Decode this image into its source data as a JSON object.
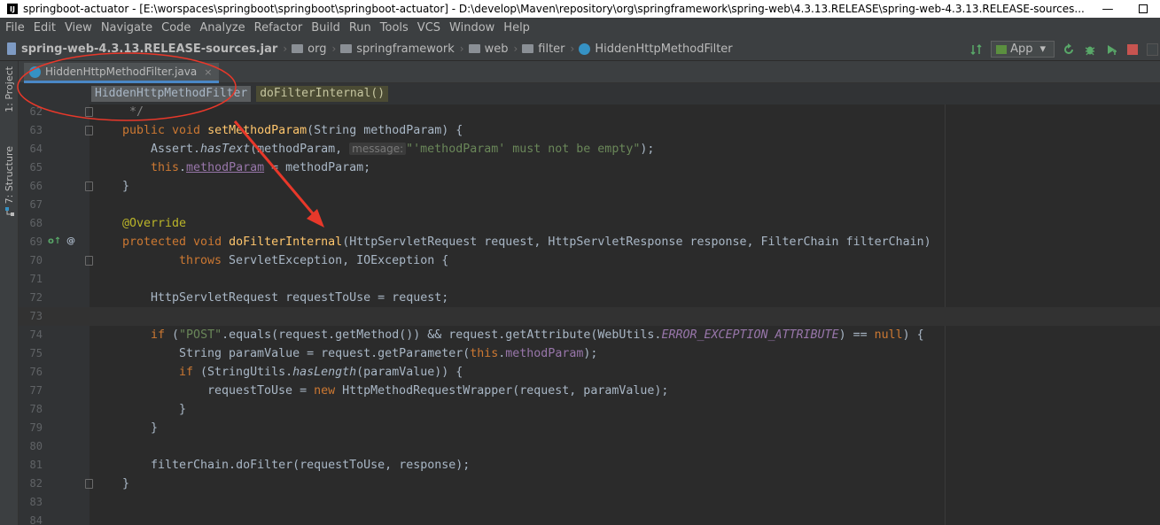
{
  "window": {
    "title": "springboot-actuator - [E:\\worspaces\\springboot\\springboot\\springboot-actuator] - D:\\develop\\Maven\\repository\\org\\springframework\\spring-web\\4.3.13.RELEASE\\spring-web-4.3.13.RELEASE-sources...",
    "minimize_glyph": "—",
    "app_icon_glyph": "IJ"
  },
  "menu": [
    "File",
    "Edit",
    "View",
    "Navigate",
    "Code",
    "Analyze",
    "Refactor",
    "Build",
    "Run",
    "Tools",
    "VCS",
    "Window",
    "Help"
  ],
  "navbar": {
    "jar": "spring-web-4.3.13.RELEASE-sources.jar",
    "crumbs": [
      "org",
      "springframework",
      "web",
      "filter",
      "HiddenHttpMethodFilter"
    ],
    "separator": "›",
    "run_config": "App",
    "run_config_arrow": "▾"
  },
  "toolstrip": {
    "project": "1: Project",
    "structure": "7: Structure"
  },
  "tab": {
    "name": "HiddenHttpMethodFilter.java",
    "close": "×"
  },
  "breadcrumb": {
    "class": "HiddenHttpMethodFilter",
    "method": "doFilterInternal()"
  },
  "code": {
    "line_numbers": [
      "62",
      "63",
      "64",
      "65",
      "66",
      "67",
      "68",
      "69",
      "70",
      "71",
      "72",
      "73",
      "74",
      "75",
      "76",
      "77",
      "78",
      "79",
      "80",
      "81",
      "82",
      "83",
      "84"
    ],
    "l62": "*/",
    "l63": {
      "kw": "public void ",
      "name": "setMethodParam",
      "rest": "(String methodParam) {"
    },
    "l64": {
      "pre": "Assert.",
      "call": "hasText",
      "mid": "(methodParam, ",
      "hint": "message:",
      "str": "\"'methodParam' must not be empty\"",
      "end": ");"
    },
    "l65": {
      "kw": "this",
      "dot": ".",
      "field": "methodParam",
      "rest": " = methodParam;"
    },
    "l66": "}",
    "l68": "@Override",
    "l69": {
      "kw": "protected void ",
      "name": "doFilterInternal",
      "rest": "(HttpServletRequest request, HttpServletResponse response, FilterChain filterChain)"
    },
    "l70": {
      "kw": "throws ",
      "rest": "ServletException, IOException {"
    },
    "l72": "HttpServletRequest requestToUse = request;",
    "l74": {
      "kw": "if ",
      "open": "(",
      "str": "\"POST\"",
      "mid": ".equals(request.getMethod()) && request.getAttribute(WebUtils.",
      "const": "ERROR_EXCEPTION_ATTRIBUTE",
      "eq": ") == ",
      "null": "null",
      "end": ") {"
    },
    "l75": {
      "pre": "String paramValue = request.getParameter(",
      "kw": "this",
      "dot": ".",
      "field": "methodParam",
      "end": ");"
    },
    "l76": {
      "kw": "if ",
      "pre": "(StringUtils.",
      "call": "hasLength",
      "end": "(paramValue)) {"
    },
    "l77": {
      "pre": "requestToUse = ",
      "kw": "new ",
      "end": "HttpMethodRequestWrapper(request, paramValue);"
    },
    "l78": "}",
    "l79": "}",
    "l81": "filterChain.doFilter(requestToUse, response);",
    "l82": "}",
    "gutter_override": "o↑",
    "gutter_annotation": "@"
  },
  "colors": {
    "keyword": "#cc7832",
    "method": "#ffc66d",
    "field": "#9876aa",
    "string": "#6a8759",
    "annotation": "#bbb529",
    "annotation_overlay": "#e8382a"
  }
}
